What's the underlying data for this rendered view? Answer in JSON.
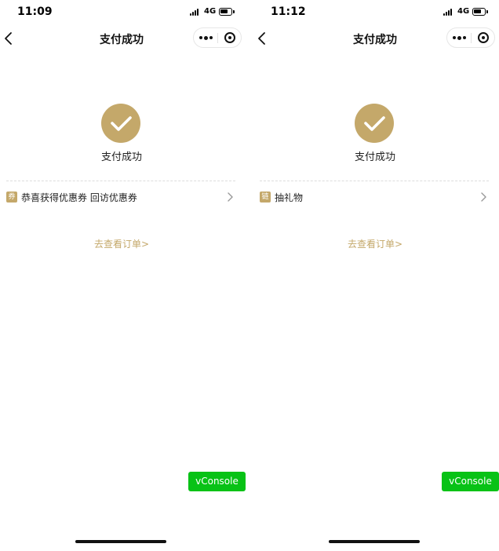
{
  "theme": {
    "accent": "#c4a86a",
    "vconsole_green": "#08c216",
    "divider": "#dcdcdc"
  },
  "screens": [
    {
      "status": {
        "time": "11:09",
        "network": "4G"
      },
      "nav": {
        "title": "支付成功",
        "back_icon": "chevron-left-icon",
        "more_icon": "more-dots-icon",
        "close_icon": "target-close-icon"
      },
      "success": {
        "icon": "checkmark-icon",
        "text": "支付成功"
      },
      "reward": {
        "badge": "券",
        "label": "恭喜获得优惠券 回访优惠券",
        "chevron_icon": "chevron-right-icon"
      },
      "order_link": "去查看订单>",
      "vconsole": "vConsole"
    },
    {
      "status": {
        "time": "11:12",
        "network": "4G"
      },
      "nav": {
        "title": "支付成功",
        "back_icon": "chevron-left-icon",
        "more_icon": "more-dots-icon",
        "close_icon": "target-close-icon"
      },
      "success": {
        "icon": "checkmark-icon",
        "text": "支付成功"
      },
      "reward": {
        "badge": "链",
        "label": "抽礼物",
        "chevron_icon": "chevron-right-icon"
      },
      "order_link": "去查看订单>",
      "vconsole": "vConsole"
    }
  ]
}
